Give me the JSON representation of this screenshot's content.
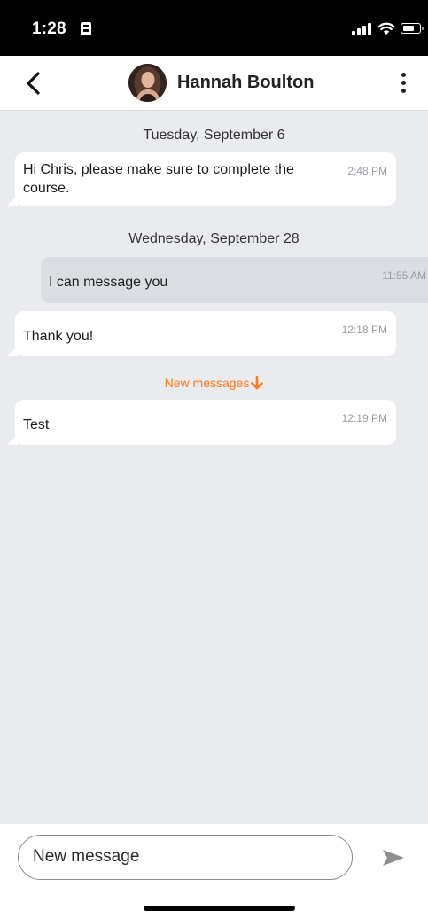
{
  "status_bar": {
    "time": "1:28"
  },
  "header": {
    "contact_name": "Hannah Boulton"
  },
  "messages": [
    {
      "type": "date",
      "text": "Tuesday, September 6"
    },
    {
      "type": "in",
      "text_line1": "Hi Chris, please make sure to complete the",
      "text_line2": "course.",
      "time": "2:48 PM"
    },
    {
      "type": "date",
      "text": "Wednesday, September 28"
    },
    {
      "type": "out",
      "text": "I can message you",
      "time": "11:55 AM"
    },
    {
      "type": "in",
      "text": "Thank you!",
      "time": "12:18 PM"
    },
    {
      "type": "in",
      "text": "Test",
      "time": "12:19 PM"
    }
  ],
  "new_messages_label": "New messages",
  "composer": {
    "placeholder": "New message"
  },
  "colors": {
    "accent": "#ff7a1a",
    "background": "#e9ebee",
    "incoming_bubble": "#ffffff",
    "outgoing_bubble": "#dadde1"
  }
}
